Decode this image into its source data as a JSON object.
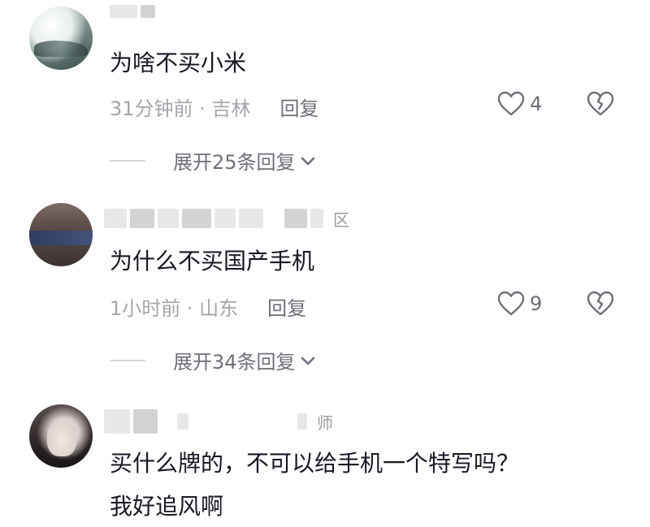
{
  "comments": [
    {
      "name_tail": "",
      "text": "为啥不买小米",
      "time": "31分钟前",
      "location": "吉林",
      "reply_label": "回复",
      "likes": "4",
      "expand_label": "展开25条回复"
    },
    {
      "name_tail": "区",
      "text": "为什么不买国产手机",
      "time": "1小时前",
      "location": "山东",
      "reply_label": "回复",
      "likes": "9",
      "expand_label": "展开34条回复"
    },
    {
      "name_tail": "师",
      "text_line1": "买什么牌的，不可以给手机一个特写吗？",
      "text_line2": "我好追风啊"
    }
  ],
  "separator": " · ",
  "icons": {
    "like": "heart-outline-icon",
    "dislike": "broken-heart-icon",
    "expand": "chevron-down-icon"
  },
  "colors": {
    "text": "#161823",
    "meta": "#a4a6ab",
    "action": "#6e7079"
  }
}
